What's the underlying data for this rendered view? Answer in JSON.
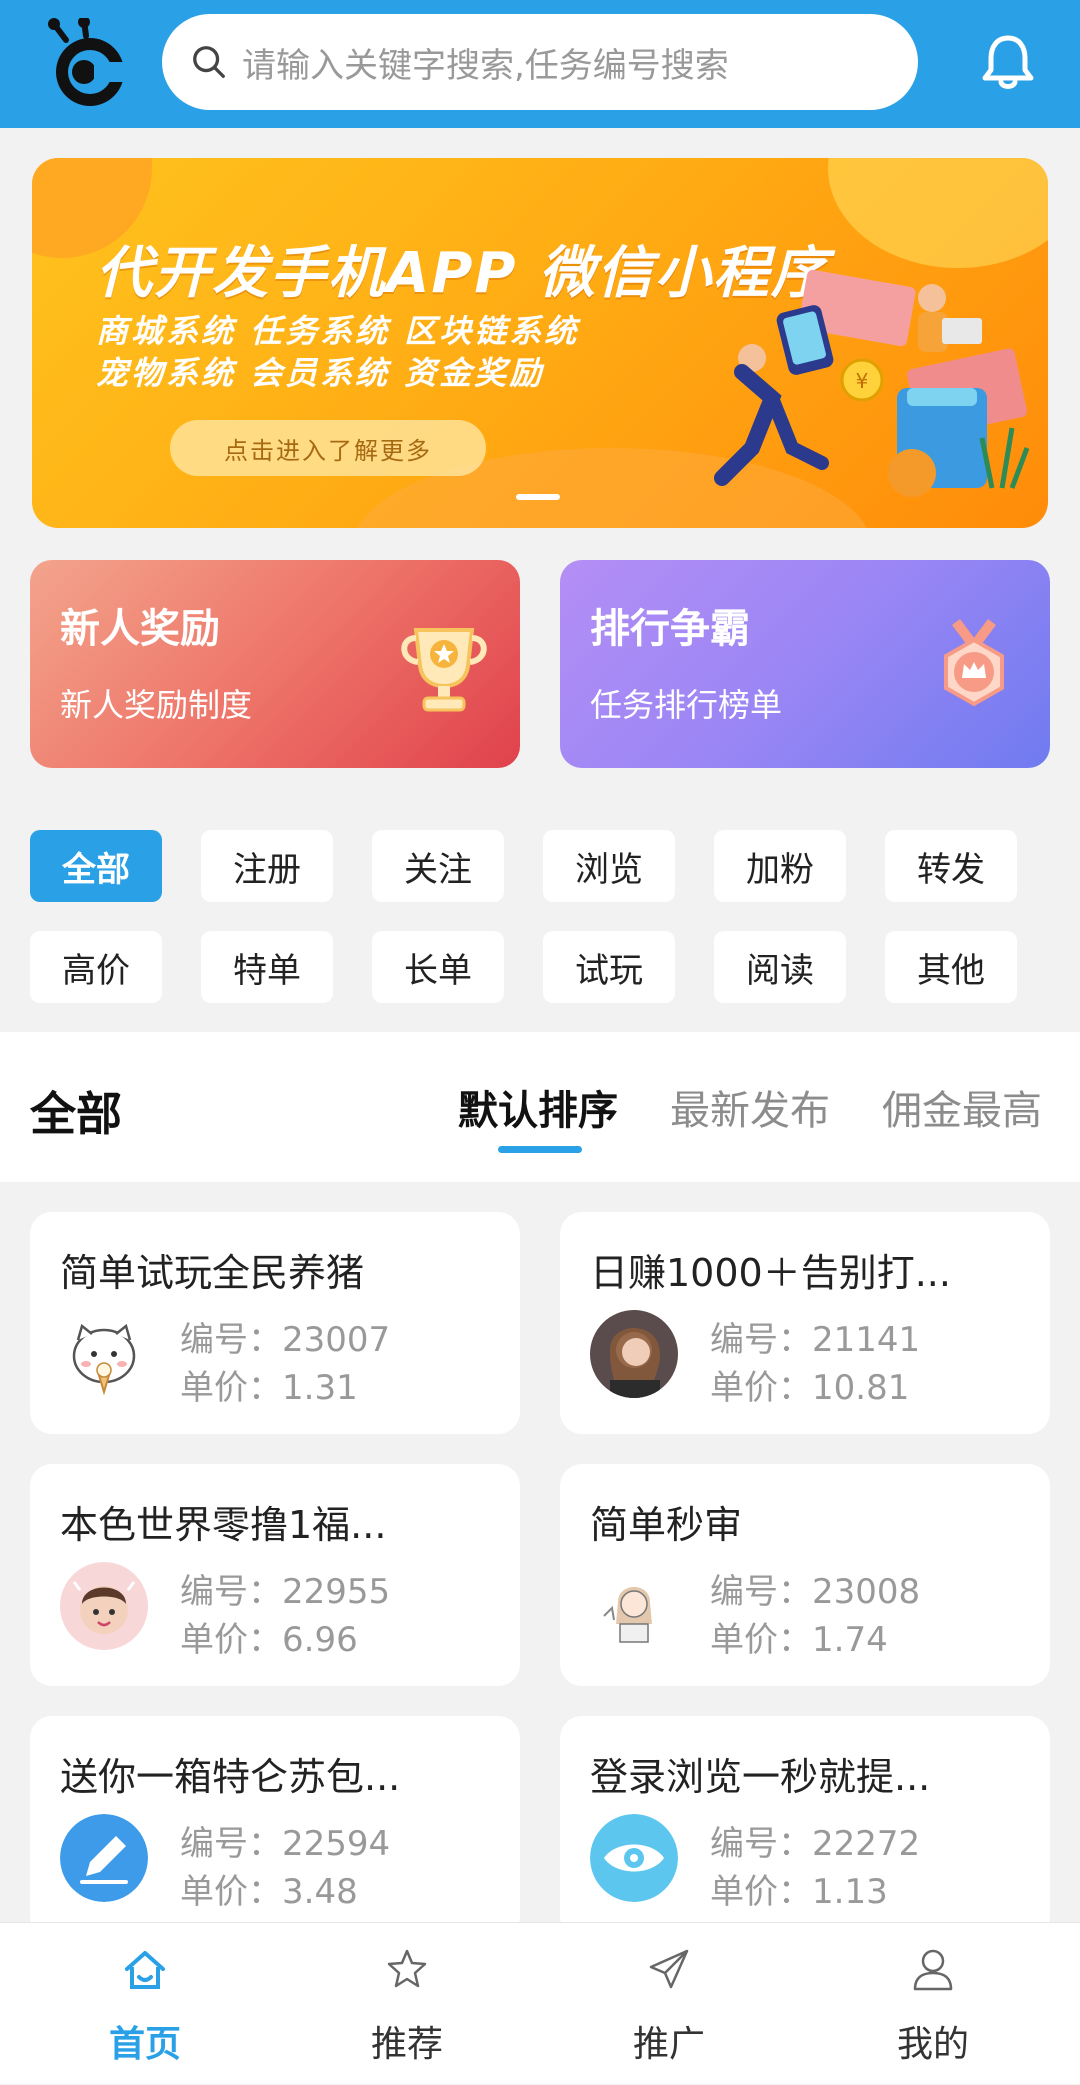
{
  "header": {
    "search_placeholder": "请输入关键字搜索,任务编号搜索",
    "icons": [
      "logo-icon",
      "search-icon",
      "bell-icon"
    ]
  },
  "banner": {
    "title": "代开发手机APP 微信小程序",
    "line1": "商城系统 任务系统 区块链系统",
    "line2": "宠物系统 会员系统 资金奖励",
    "cta": "点击进入了解更多"
  },
  "promos": [
    {
      "title": "新人奖励",
      "subtitle": "新人奖励制度",
      "icon": "trophy-icon"
    },
    {
      "title": "排行争霸",
      "subtitle": "任务排行榜单",
      "icon": "medal-icon"
    }
  ],
  "categories": [
    "全部",
    "注册",
    "关注",
    "浏览",
    "加粉",
    "转发",
    "高价",
    "特单",
    "长单",
    "试玩",
    "阅读",
    "其他"
  ],
  "active_category": "全部",
  "list": {
    "label": "全部",
    "sorts": [
      "默认排序",
      "最新发布",
      "佣金最高"
    ],
    "active_sort": "默认排序"
  },
  "tasks": [
    {
      "title": "简单试玩全民养猪",
      "id_label": "编号：23007",
      "price_label": "单价：1.31",
      "avatar": "cat-avatar"
    },
    {
      "title": "日赚1000＋告别打...",
      "id_label": "编号：21141",
      "price_label": "单价：10.81",
      "avatar": "girl-avatar"
    },
    {
      "title": "本色世界零撸1福...",
      "id_label": "编号：22955",
      "price_label": "单价：6.96",
      "avatar": "baby-avatar"
    },
    {
      "title": "简单秒审",
      "id_label": "编号：23008",
      "price_label": "单价：1.74",
      "avatar": "sketch-avatar"
    },
    {
      "title": "送你一箱特仑苏包...",
      "id_label": "编号：22594",
      "price_label": "单价：3.48",
      "avatar": "pencil-avatar"
    },
    {
      "title": "登录浏览一秒就提...",
      "id_label": "编号：22272",
      "price_label": "单价：1.13",
      "avatar": "eye-avatar"
    }
  ],
  "nav": [
    {
      "label": "首页",
      "icon": "home-icon"
    },
    {
      "label": "推荐",
      "icon": "star-icon"
    },
    {
      "label": "推广",
      "icon": "send-icon"
    },
    {
      "label": "我的",
      "icon": "user-icon"
    }
  ],
  "colors": {
    "accent": "#2aa0e6",
    "banner": "#ffb414",
    "promo_red": "#e9595d",
    "promo_purple": "#8d83f3"
  }
}
